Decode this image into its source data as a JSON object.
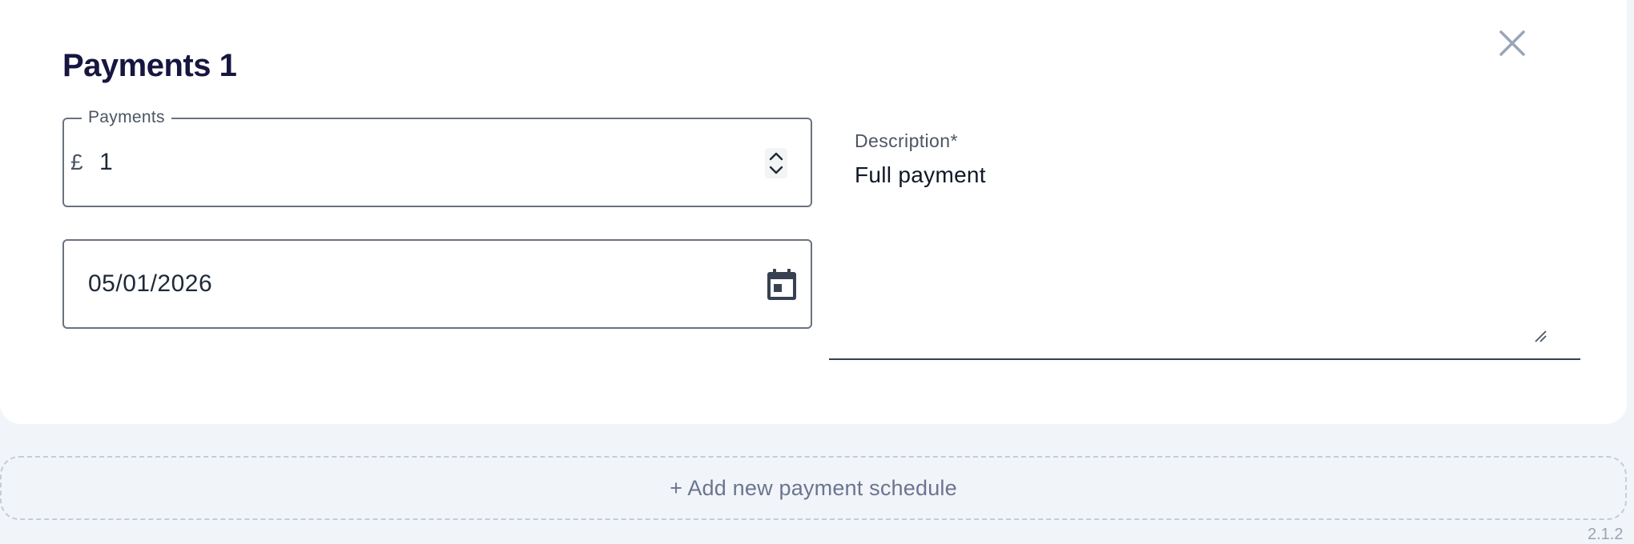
{
  "modal": {
    "title": "Payments 1",
    "close_icon": "close-icon"
  },
  "amount_field": {
    "label": "Payments",
    "currency_symbol": "£",
    "value": "1",
    "spinner_icon": "chevron-up-down-icon"
  },
  "date_field": {
    "value": "05/01/2026",
    "icon": "calendar-icon"
  },
  "description_field": {
    "label": "Description*",
    "value": "Full payment",
    "resize_icon": "resize-handle-icon"
  },
  "add_schedule": {
    "label": "+ Add new payment schedule"
  },
  "footer": {
    "partial_text": "2.1.2"
  },
  "colors": {
    "background": "#f1f5f9",
    "card": "#ffffff",
    "title": "#16163f",
    "border": "#6b7280",
    "muted_text": "#6b7490"
  }
}
